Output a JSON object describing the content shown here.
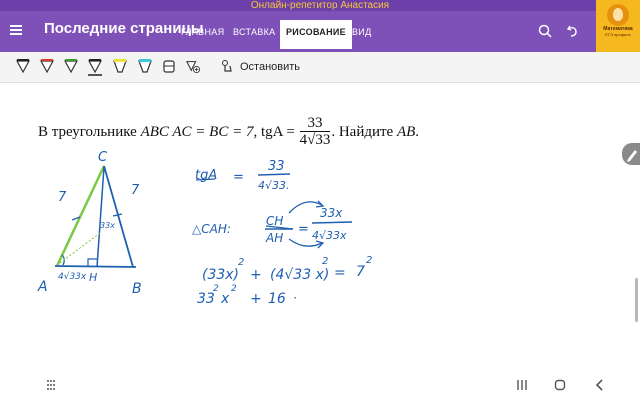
{
  "window": {
    "title": "Онлайн-репетитор Анастасия"
  },
  "appbar": {
    "title": "Последние страницы",
    "tabs": [
      {
        "label": "ГЛАВНАЯ",
        "active": false
      },
      {
        "label": "ВСТАВКА",
        "active": false
      },
      {
        "label": "РИСОВАНИЕ",
        "active": true
      },
      {
        "label": "ВИД",
        "active": false
      }
    ]
  },
  "brand": {
    "title": "Математика",
    "subtitle": "ЕГЭ профиль"
  },
  "toolbar": {
    "pens": [
      "black",
      "red",
      "green",
      "black",
      "yellow",
      "cyan",
      "blue",
      "purple"
    ],
    "stop_label": "Остановить"
  },
  "problem": {
    "prefix": "В треугольнике",
    "condition": "ABC AC = BC = 7,",
    "tg_label": "tgA =",
    "frac_num": "33",
    "frac_den_coef": "4",
    "frac_den_rad": "33",
    "suffix": ". Найдите",
    "target": "AB",
    "end": "."
  },
  "handwriting": {
    "vertex_c": "C",
    "vertex_a": "A",
    "vertex_b": "B",
    "vertex_h": "H",
    "side_ac": "7",
    "side_bc": "7",
    "segment_ah": "4√33x",
    "segment_ch": "33x",
    "tg_left": "tgA",
    "tg_eq": "=",
    "tg_num": "33",
    "tg_den": "4√33.",
    "cah_label": "△CAH:",
    "ratio_num": "CH",
    "ratio_den": "AH",
    "ratio_eq": "=",
    "ratio_rnum": "33x",
    "ratio_rden": "4√33x",
    "eq1_a": "(33x)",
    "eq1_pow1": "2",
    "eq1_plus": "+",
    "eq1_b": "(4√33 x)",
    "eq1_pow2": "2",
    "eq1_eq": "=",
    "eq1_rhs": "7",
    "eq1_pow3": "2",
    "eq2_a": "33",
    "eq2_pow_a": "2",
    "eq2_x": "x",
    "eq2_pow_x": "2",
    "eq2_plus": "+",
    "eq2_b": "16",
    "eq2_dot": "·"
  },
  "colors": {
    "appbar": "#7e51b8",
    "titlebar": "#6d3fa8",
    "title_text": "#f7c63c",
    "brand_bg": "#f5b81e",
    "ink_blue": "#1f5fb0",
    "ink_green": "#7ac943"
  }
}
